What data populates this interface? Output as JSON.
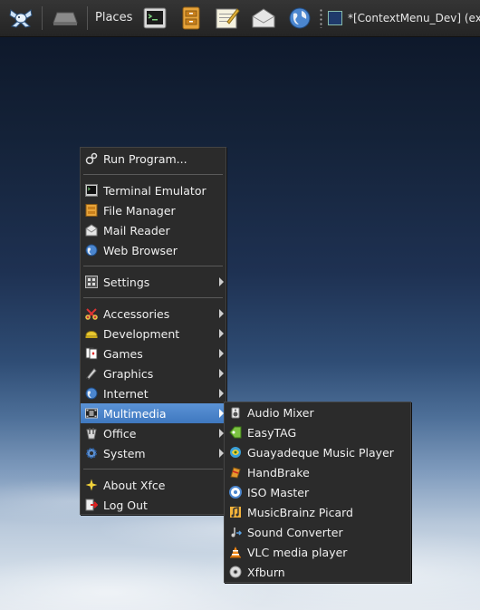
{
  "panel": {
    "places_label": "Places",
    "task_title": "*[ContextMenu_Dev] (ex",
    "launchers": [
      "app-menu-icon",
      "show-desktop-icon",
      "terminal-icon",
      "file-manager-icon",
      "text-editor-icon",
      "mail-icon",
      "web-browser-icon"
    ]
  },
  "menu": {
    "run_program": "Run Program...",
    "terminal": "Terminal Emulator",
    "file_manager": "File Manager",
    "mail_reader": "Mail Reader",
    "web_browser": "Web Browser",
    "settings": "Settings",
    "accessories": "Accessories",
    "development": "Development",
    "games": "Games",
    "graphics": "Graphics",
    "internet": "Internet",
    "multimedia": "Multimedia",
    "office": "Office",
    "system": "System",
    "about": "About Xfce",
    "logout": "Log Out"
  },
  "submenu": {
    "items": [
      "Audio Mixer",
      "EasyTAG",
      "Guayadeque Music Player",
      "HandBrake",
      "ISO Master",
      "MusicBrainz Picard",
      "Sound Converter",
      "VLC media player",
      "Xfburn"
    ]
  },
  "colors": {
    "highlight": "#4a86cf",
    "menu_bg": "#2b2b2b",
    "panel_bg": "#2c2c2c"
  }
}
